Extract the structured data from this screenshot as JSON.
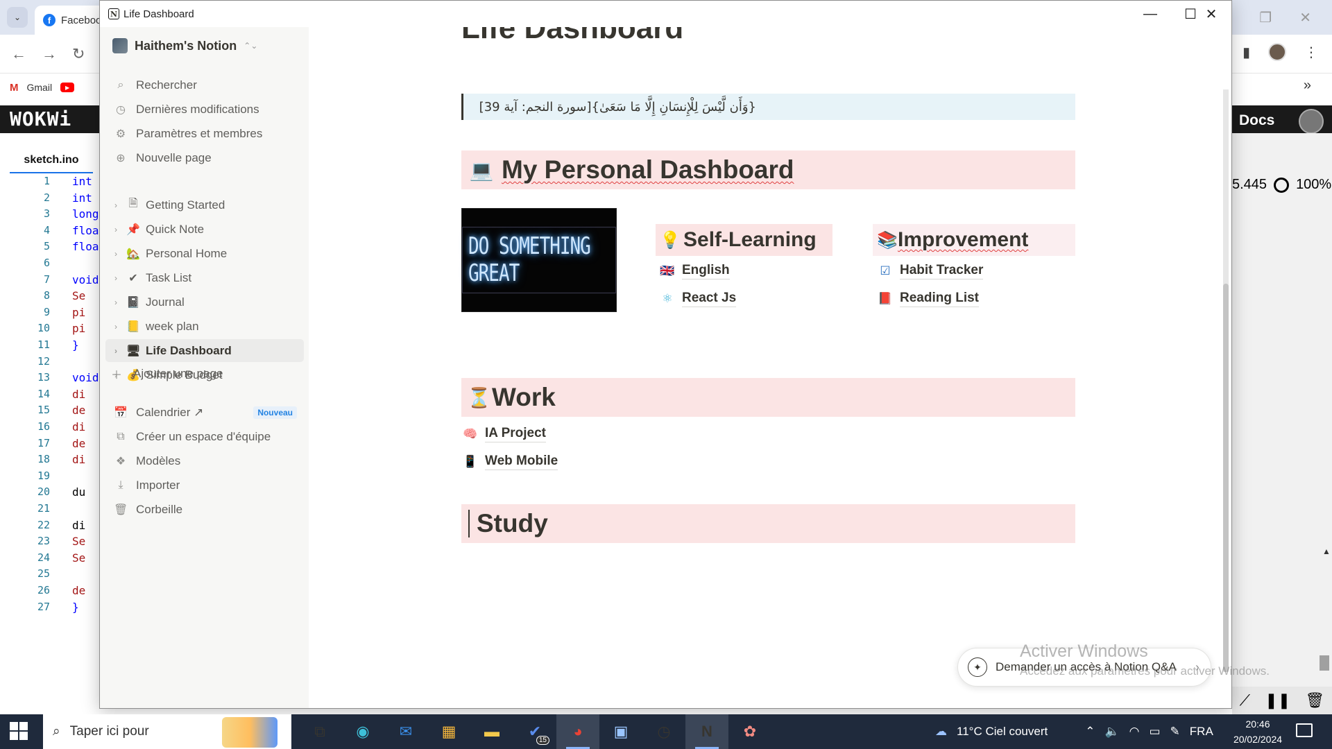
{
  "chrome": {
    "tab_title": "Faceboo",
    "bookmarks": [
      {
        "label": "Gmail"
      }
    ],
    "wokwi_logo": "WOKWi",
    "wokwi_docs": "Docs",
    "code_tab": "sketch.ino",
    "sim_readout": "5.445",
    "sim_percent": "100%",
    "code_lines": [
      {
        "n": "1",
        "t": "int",
        "c": "kw"
      },
      {
        "n": "2",
        "t": "int",
        "c": "kw"
      },
      {
        "n": "3",
        "t": "long",
        "c": "kw"
      },
      {
        "n": "4",
        "t": "floa",
        "c": "kw"
      },
      {
        "n": "5",
        "t": "floa",
        "c": "kw"
      },
      {
        "n": "6",
        "t": "",
        "c": "pl"
      },
      {
        "n": "7",
        "t": "void",
        "c": "kw"
      },
      {
        "n": "8",
        "t": "  Se",
        "c": "fn"
      },
      {
        "n": "9",
        "t": "  pi",
        "c": "fn"
      },
      {
        "n": "10",
        "t": "  pi",
        "c": "fn"
      },
      {
        "n": "11",
        "t": "}",
        "c": "kw"
      },
      {
        "n": "12",
        "t": "",
        "c": "pl"
      },
      {
        "n": "13",
        "t": "void",
        "c": "kw"
      },
      {
        "n": "14",
        "t": "  di",
        "c": "fn"
      },
      {
        "n": "15",
        "t": "  de",
        "c": "fn"
      },
      {
        "n": "16",
        "t": "  di",
        "c": "fn"
      },
      {
        "n": "17",
        "t": "  de",
        "c": "fn"
      },
      {
        "n": "18",
        "t": "  di",
        "c": "fn"
      },
      {
        "n": "19",
        "t": "",
        "c": "pl"
      },
      {
        "n": "20",
        "t": "  du",
        "c": "pl"
      },
      {
        "n": "21",
        "t": "",
        "c": "pl"
      },
      {
        "n": "22",
        "t": "  di",
        "c": "pl"
      },
      {
        "n": "23",
        "t": "  Se",
        "c": "fn"
      },
      {
        "n": "24",
        "t": "  Se",
        "c": "fn"
      },
      {
        "n": "25",
        "t": "",
        "c": "pl"
      },
      {
        "n": "26",
        "t": "  de",
        "c": "fn"
      },
      {
        "n": "27",
        "t": "}",
        "c": "kw"
      }
    ]
  },
  "window": {
    "title": "Life Dashboard"
  },
  "sidebar": {
    "workspace": "Haithem's Notion",
    "actions": [
      {
        "label": "Rechercher",
        "icon": "search-icon",
        "glyph": "⌕"
      },
      {
        "label": "Dernières modifications",
        "icon": "clock-icon",
        "glyph": "◷"
      },
      {
        "label": "Paramètres et membres",
        "icon": "gear-icon",
        "glyph": "⚙"
      },
      {
        "label": "Nouvelle page",
        "icon": "plus-circle-icon",
        "glyph": "⊕"
      }
    ],
    "pages": [
      {
        "label": "Getting Started",
        "icon": "page-icon",
        "glyph": "🗎",
        "active": false
      },
      {
        "label": "Quick Note",
        "icon": "pushpin-icon",
        "glyph": "📌",
        "active": false
      },
      {
        "label": "Personal Home",
        "icon": "house-icon",
        "glyph": "🏡",
        "active": false
      },
      {
        "label": "Task List",
        "icon": "checkmark-icon",
        "glyph": "✔",
        "active": false
      },
      {
        "label": "Journal",
        "icon": "notebook-icon",
        "glyph": "📓",
        "active": false
      },
      {
        "label": "week plan",
        "icon": "ledger-icon",
        "glyph": "📒",
        "active": false
      },
      {
        "label": "Life Dashboard",
        "icon": "desktop-icon",
        "glyph": "🖥",
        "active": true
      },
      {
        "label": "Simple Budget",
        "icon": "money-icon",
        "glyph": "💰",
        "active": false
      }
    ],
    "add_page": "Ajouter une page",
    "bottom": [
      {
        "label": "Calendrier ↗",
        "icon": "calendar-icon",
        "glyph": "📅",
        "badge": "Nouveau"
      },
      {
        "label": "Créer un espace d'équipe",
        "icon": "team-space-icon",
        "glyph": "⧉",
        "badge": ""
      },
      {
        "label": "Modèles",
        "icon": "templates-icon",
        "glyph": "❖",
        "badge": ""
      },
      {
        "label": "Importer",
        "icon": "import-icon",
        "glyph": "⤓",
        "badge": ""
      },
      {
        "label": "Corbeille",
        "icon": "trash-icon",
        "glyph": "🗑",
        "badge": ""
      }
    ]
  },
  "content": {
    "page_title": "Life Dashboard",
    "quote": "[سورة النجم: آية 39]{وَأَن لَّيْسَ لِلْإِنسَانِ إِلَّا مَا سَعَىٰ}",
    "dashboard": {
      "emoji": "💻",
      "title": "My Personal Dashboard"
    },
    "cover_text": "DO SOMETHING GREAT",
    "self_learning": {
      "emoji": "💡",
      "title": "Self-Learning",
      "items": [
        {
          "emoji": "🇬🇧",
          "label": "English"
        },
        {
          "emoji": "⚛",
          "label": "React Js"
        }
      ]
    },
    "improvement": {
      "emoji": "📚",
      "title": "Improvement",
      "items": [
        {
          "emoji": "☑",
          "label": "Habit Tracker"
        },
        {
          "emoji": "📕",
          "label": "Reading List"
        }
      ]
    },
    "work": {
      "emoji": "⏳",
      "title": "Work",
      "items": [
        {
          "emoji": "🧠",
          "label": "IA Project"
        },
        {
          "emoji": "📱",
          "label": "Web Mobile"
        }
      ]
    },
    "study": {
      "title": "Study"
    },
    "qa_button": "Demander un accès à Notion Q&A"
  },
  "watermark": {
    "line1": "Activer Windows",
    "line2": "Accédez aux paramètres pour activer Windows."
  },
  "taskbar": {
    "search_placeholder": "Taper ici pour",
    "mail_badge": "15",
    "weather": "11°C  Ciel couvert",
    "lang": "FRA",
    "time": "20:46",
    "date": "20/02/2024"
  }
}
